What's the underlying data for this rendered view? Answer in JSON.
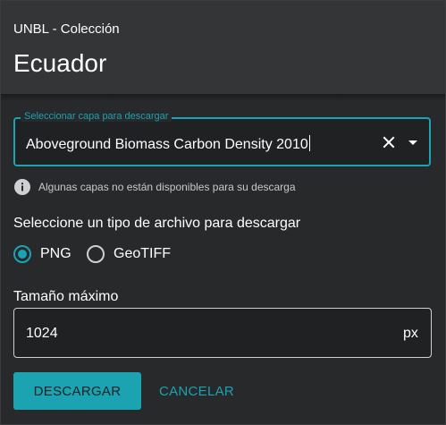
{
  "header": {
    "subtitle": "UNBL - Colección",
    "title": "Ecuador"
  },
  "layer_select": {
    "label": "Seleccionar capa para descargar",
    "value": "Aboveground Biomass Carbon Density 2010",
    "clear_icon": "close-icon",
    "dropdown_icon": "caret-down-icon"
  },
  "info": {
    "icon": "info-icon",
    "text": "Algunas capas no están disponibles para su descarga"
  },
  "file_type": {
    "label": "Seleccione un tipo de archivo para descargar",
    "options": [
      {
        "label": "PNG",
        "checked": true
      },
      {
        "label": "GeoTIFF",
        "checked": false
      }
    ]
  },
  "max_size": {
    "label": "Tamaño máximo",
    "value": "1024",
    "unit": "px"
  },
  "actions": {
    "download_label": "DESCARGAR",
    "cancel_label": "CANCELAR"
  },
  "colors": {
    "accent": "#1ba3b1",
    "background": "#27292b",
    "header": "#333537"
  }
}
